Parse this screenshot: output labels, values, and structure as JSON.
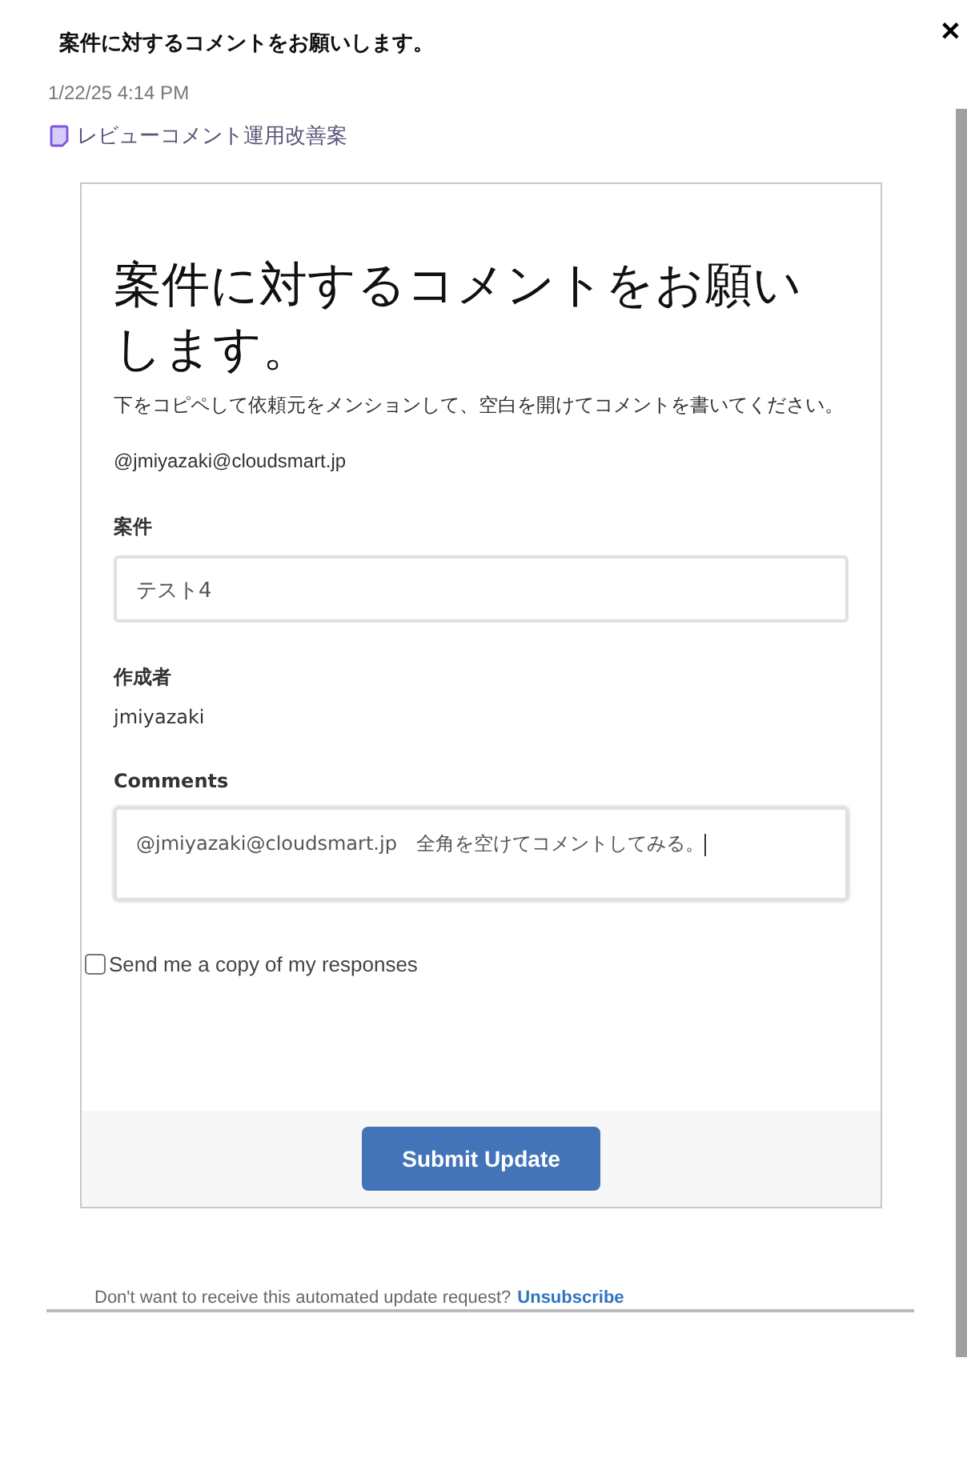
{
  "header": {
    "title": "案件に対するコメントをお願いします。",
    "close": "✕"
  },
  "timestamp": "1/22/25 4:14 PM",
  "document_link": "レビューコメント運用改善案",
  "form": {
    "heading": "案件に対するコメントをお願いします。",
    "description": "下をコピペして依頼元をメンションして、空白を開けてコメントを書いてください。",
    "mention": "@jmiyazaki@cloudsmart.jp",
    "fields": [
      {
        "kind": "input",
        "label": "案件",
        "value": "テスト4"
      },
      {
        "kind": "static",
        "label": "作成者",
        "value": "jmiyazaki"
      },
      {
        "kind": "textarea",
        "label": "Comments",
        "value": "@jmiyazaki@cloudsmart.jp　全角を空けてコメントしてみる。"
      }
    ],
    "copy_checkbox": {
      "label": "Send me a copy of my responses",
      "checked": false
    },
    "submit": "Submit Update"
  },
  "footer": {
    "text": "Don't want to receive this automated update request?",
    "link": "Unsubscribe"
  }
}
